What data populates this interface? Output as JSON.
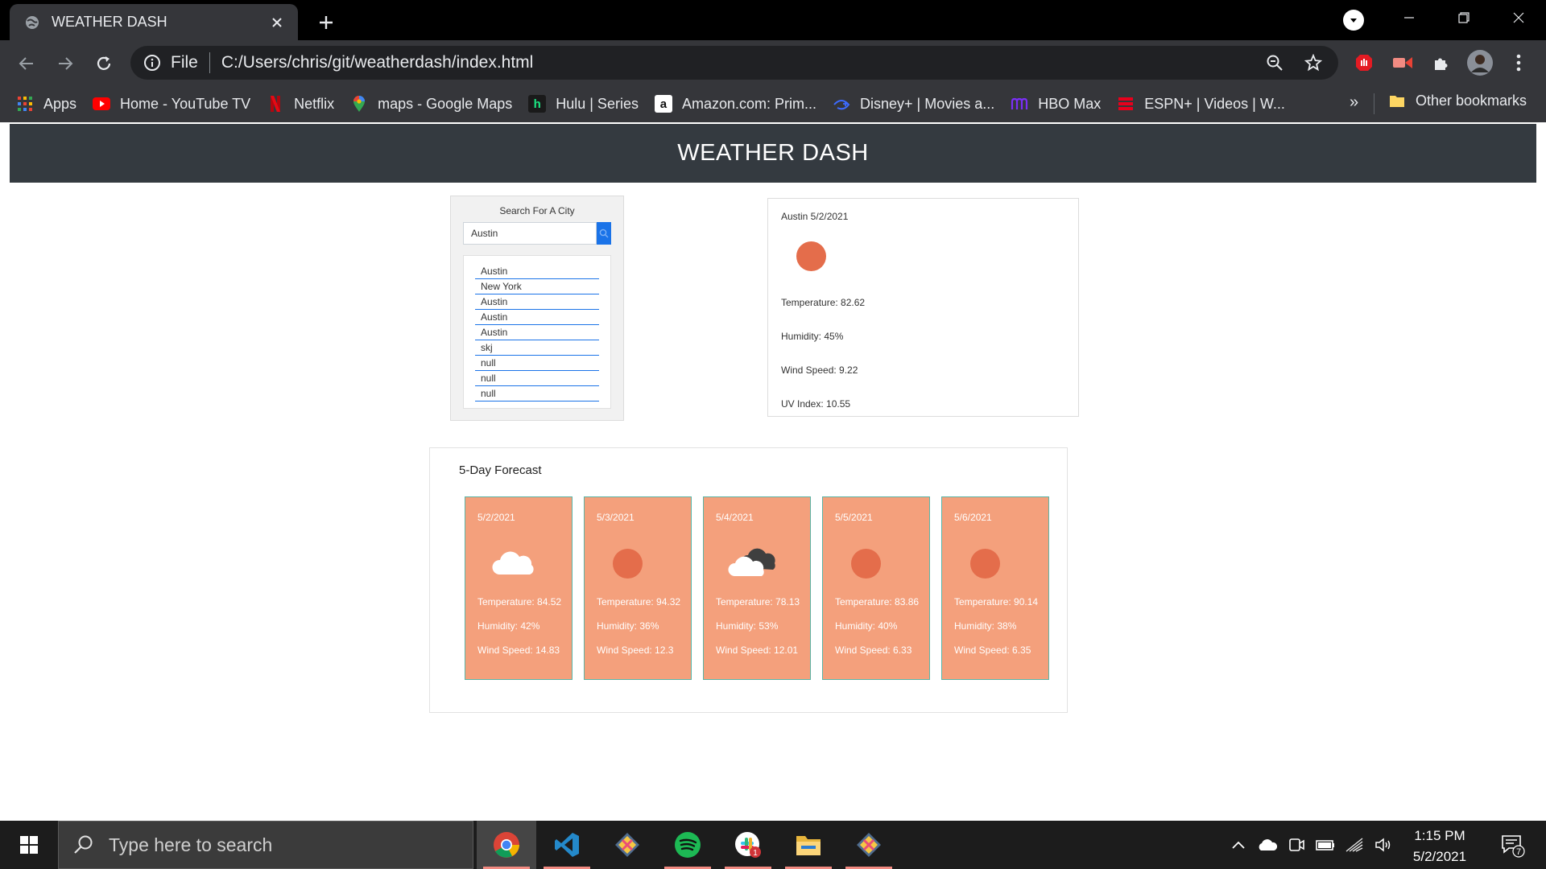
{
  "browser": {
    "tab_title": "WEATHER DASH",
    "protocol_label": "File",
    "url": "C:/Users/chris/git/weatherdash/index.html",
    "bookmarks": [
      {
        "label": "Apps",
        "icon": "apps-grid-icon"
      },
      {
        "label": "Home - YouTube TV",
        "icon": "youtube-icon"
      },
      {
        "label": "Netflix",
        "icon": "netflix-icon"
      },
      {
        "label": "maps - Google Maps",
        "icon": "google-maps-icon"
      },
      {
        "label": "Hulu | Series",
        "icon": "hulu-icon"
      },
      {
        "label": "Amazon.com: Prim...",
        "icon": "amazon-icon"
      },
      {
        "label": "Disney+ | Movies a...",
        "icon": "disney-plus-icon"
      },
      {
        "label": "HBO Max",
        "icon": "hbo-max-icon"
      },
      {
        "label": "ESPN+ | Videos | W...",
        "icon": "espn-icon"
      }
    ],
    "more_bookmarks": "»",
    "other_bookmarks": "Other bookmarks"
  },
  "app": {
    "header_title": "WEATHER DASH",
    "search": {
      "title": "Search For A City",
      "input_value": "Austin",
      "history": [
        "Austin",
        "New York",
        "Austin",
        "Austin",
        "Austin",
        "skj",
        "null",
        "null",
        "null"
      ]
    },
    "current": {
      "heading": "Austin 5/2/2021",
      "icon": "sun-icon",
      "temperature": "Temperature: 82.62",
      "humidity": "Humidity: 45%",
      "wind": "Wind Speed: 9.22",
      "uv": "UV Index: 10.55"
    },
    "forecast": {
      "title": "5-Day Forecast",
      "days": [
        {
          "date": "5/2/2021",
          "icon": "cloud-icon",
          "temperature": "Temperature: 84.52",
          "humidity": "Humidity: 42%",
          "wind": "Wind Speed: 14.83"
        },
        {
          "date": "5/3/2021",
          "icon": "sun-icon",
          "temperature": "Temperature: 94.32",
          "humidity": "Humidity: 36%",
          "wind": "Wind Speed: 12.3"
        },
        {
          "date": "5/4/2021",
          "icon": "broken-clouds-icon",
          "temperature": "Temperature: 78.13",
          "humidity": "Humidity: 53%",
          "wind": "Wind Speed: 12.01"
        },
        {
          "date": "5/5/2021",
          "icon": "sun-icon",
          "temperature": "Temperature: 83.86",
          "humidity": "Humidity: 40%",
          "wind": "Wind Speed: 6.33"
        },
        {
          "date": "5/6/2021",
          "icon": "sun-icon",
          "temperature": "Temperature: 90.14",
          "humidity": "Humidity: 38%",
          "wind": "Wind Speed: 6.35"
        }
      ]
    }
  },
  "taskbar": {
    "search_placeholder": "Type here to search",
    "apps": [
      "chrome-icon",
      "vscode-icon",
      "git-kraken-icon",
      "spotify-icon",
      "slack-icon",
      "file-explorer-icon",
      "git-kraken-icon"
    ],
    "slack_badge": "1",
    "time": "1:15 PM",
    "date": "5/2/2021",
    "notification_count": "7"
  },
  "colors": {
    "header_bg": "#343a40",
    "search_button": "#1a73e8",
    "forecast_card": "#f4a07c",
    "forecast_border": "#5ab4a6",
    "sun": "#e46d4b"
  }
}
